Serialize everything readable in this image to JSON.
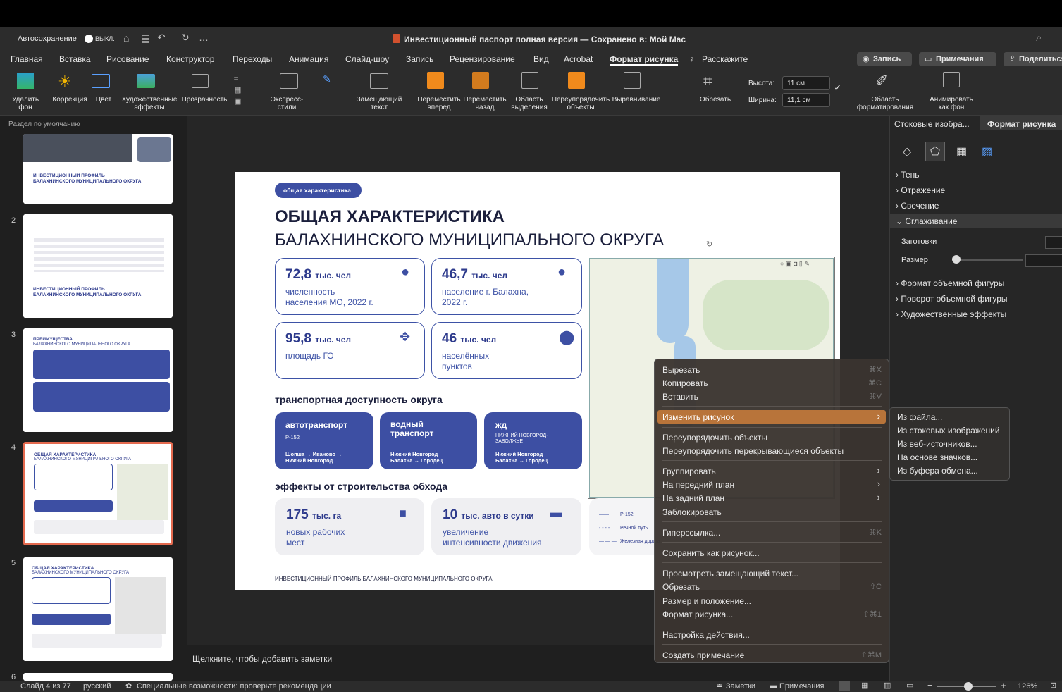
{
  "titlebar": {
    "autosave_label": "Автосохранение",
    "autosave_state": "ВЫКЛ.",
    "doc_title": "Инвестиционный паспорт полная версия — Сохранено в: Мой Mac"
  },
  "menubar": {
    "items": [
      "Главная",
      "Вставка",
      "Рисование",
      "Конструктор",
      "Переходы",
      "Анимация",
      "Слайд-шоу",
      "Запись",
      "Рецензирование",
      "Вид",
      "Acrobat",
      "Формат рисунка",
      "Расскажите"
    ],
    "record_button": "Запись",
    "comments_button": "Примечания",
    "share_button": "Поделиться"
  },
  "ribbon": {
    "remove_bg": "Удалить фон",
    "corrections": "Коррекция",
    "color": "Цвет",
    "artistic": "Художественные эффекты",
    "transparency": "Прозрачность",
    "quick_styles": "Экспресс-стили",
    "alt_text": "Замещающий текст",
    "bring_forward": "Переместить вперед",
    "send_backward": "Переместить назад",
    "selection_pane": "Область выделения",
    "arrange": "Переупорядочить объекты",
    "align": "Выравнивание",
    "crop": "Обрезать",
    "height_label": "Высота:",
    "height_value": "11 см",
    "width_label": "Ширина:",
    "width_value": "11,1 см",
    "format_pane": "Область форматирования",
    "animate_bg": "Анимировать как фон"
  },
  "left_panel": {
    "section": "Раздел по умолчанию",
    "slide_numbers": [
      "2",
      "3",
      "4",
      "5",
      "6"
    ],
    "thumb1_title": "ИНВЕСТИЦИОННЫЙ ПРОФИЛЬ\nБАЛАХНИНСКОГО МУНИЦИПАЛЬНОГО ОКРУГА",
    "thumb3_title": "ПРЕИМУЩЕСТВА",
    "thumb3_sub": "БАЛАХНИНСКОГО МУНИЦИПАЛЬНОГО ОКРУГА"
  },
  "slide": {
    "tag": "общая характеристика",
    "title_line1": "ОБЩАЯ ХАРАКТЕРИСТИКА",
    "title_line2": "БАЛАХНИНСКОГО МУНИЦИПАЛЬНОГО ОКРУГА",
    "stats": [
      {
        "value": "72,8",
        "unit": "тыс. чел",
        "caption": "численность\nнаселения МО, 2022 г."
      },
      {
        "value": "46,7",
        "unit": "тыс. чел",
        "caption": "население г. Балахна,\n2022 г."
      },
      {
        "value": "95,8",
        "unit": "тыс. чел",
        "caption": "площадь ГО"
      },
      {
        "value": "46",
        "unit": "тыс. чел",
        "caption": "населённых\nпунктов"
      }
    ],
    "transport_heading": "транспортная доступность округа",
    "transport": [
      {
        "title": "автотранспорт",
        "code": "Р-152",
        "route": "Шопша → Иваново →\nНижний Новгород"
      },
      {
        "title": "водный\nтранспорт",
        "code": "",
        "route": "Нижний Новгород →\nБалахна → Городец"
      },
      {
        "title": "жд",
        "code": "НИЖНИЙ НОВГОРОД-\nЗАВОЛЖЬЕ",
        "route": "Нижний Новгород →\nБалахна → Городец"
      }
    ],
    "effects_heading": "эффекты от строительства обхода",
    "effects": [
      {
        "value": "175",
        "unit": "тыс. га",
        "caption": "новых рабочих\nмест"
      },
      {
        "value": "10",
        "unit": "тыс. авто в сутки",
        "caption": "увеличение\nинтенсивности движения"
      }
    ],
    "legend": [
      "Р-152",
      "Речной путь",
      "Железная дорога"
    ],
    "footer": "ИНВЕСТИЦИОННЫЙ ПРОФИЛЬ БАЛАХНИНСКОГО МУНИЦИПАЛЬНОГО ОКРУГА"
  },
  "notes_placeholder": "Щелкните, чтобы добавить заметки",
  "right_panel": {
    "tab1": "Стоковые изобра...",
    "tab2": "Формат рисунка",
    "sections": [
      "Тень",
      "Отражение",
      "Свечение",
      "Сглаживание"
    ],
    "presets_label": "Заготовки",
    "size_label": "Размер",
    "sections2": [
      "Формат объемной фигуры",
      "Поворот объемной фигуры",
      "Художественные эффекты"
    ]
  },
  "context_menu": {
    "items": [
      {
        "label": "Вырезать",
        "shortcut": "⌘X"
      },
      {
        "label": "Копировать",
        "shortcut": "⌘C"
      },
      {
        "label": "Вставить",
        "shortcut": "⌘V"
      },
      {
        "label": "Изменить рисунок",
        "shortcut": ""
      },
      {
        "label": "Переупорядочить объекты",
        "shortcut": ""
      },
      {
        "label": "Переупорядочить перекрывающиеся объекты",
        "shortcut": ""
      },
      {
        "label": "Группировать",
        "shortcut": ""
      },
      {
        "label": "На передний план",
        "shortcut": ""
      },
      {
        "label": "На задний план",
        "shortcut": ""
      },
      {
        "label": "Заблокировать",
        "shortcut": ""
      },
      {
        "label": "Гиперссылка...",
        "shortcut": "⌘K"
      },
      {
        "label": "Сохранить как рисунок...",
        "shortcut": ""
      },
      {
        "label": "Просмотреть замещающий текст...",
        "shortcut": ""
      },
      {
        "label": "Обрезать",
        "shortcut": "⇧C"
      },
      {
        "label": "Размер и положение...",
        "shortcut": ""
      },
      {
        "label": "Формат рисунка...",
        "shortcut": "⇧⌘1"
      },
      {
        "label": "Настройка действия...",
        "shortcut": ""
      },
      {
        "label": "Создать примечание",
        "shortcut": "⇧⌘M"
      }
    ]
  },
  "submenu": {
    "items": [
      "Из файла...",
      "Из стоковых изображений",
      "Из веб-источников...",
      "На основе значков...",
      "Из буфера обмена..."
    ]
  },
  "statusbar": {
    "slide_info": "Слайд 4 из 77",
    "language": "русский",
    "accessibility": "Специальные возможности: проверьте рекомендации",
    "notes": "Заметки",
    "comments": "Примечания",
    "zoom": "126%"
  },
  "colors": {
    "accent": "#3d4fa3",
    "highlight": "#b8743a",
    "thumb_selected": "#e46a4f"
  }
}
